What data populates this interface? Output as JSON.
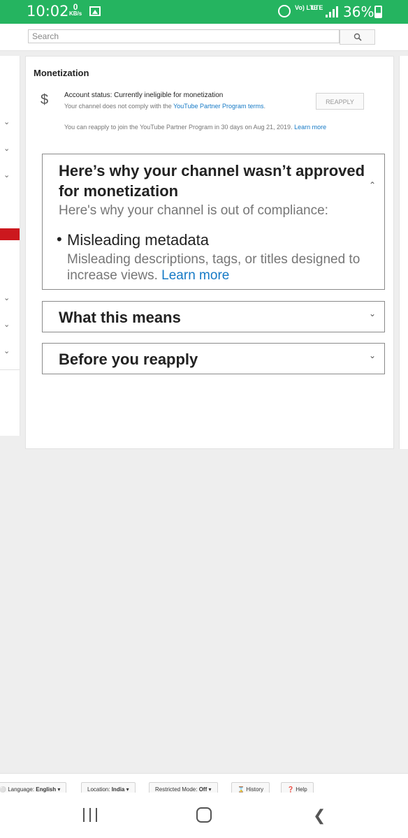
{
  "status_bar": {
    "time": "10:02",
    "net_speed_value": "0",
    "net_speed_unit": "KB/s",
    "volte": "Vo) LTE",
    "lte": "LTE",
    "battery": "36%"
  },
  "topbar": {
    "search_placeholder": "Search"
  },
  "monetization": {
    "heading": "Monetization",
    "account_status": "Account status: Currently ineligible for monetization",
    "compliance_text": "Your channel does not comply with the",
    "compliance_link": "YouTube Partner Program terms",
    "compliance_end": ".",
    "reapply_button": "REAPPLY",
    "reapply_note": "You can reapply to join the YouTube Partner Program in 30 days on Aug 21, 2019.",
    "reapply_learn_more": "Learn more"
  },
  "panels": {
    "why": {
      "title": "Here’s why your channel wasn’t approved for monetization",
      "subtitle": "Here's why your channel is out of compliance:",
      "issue": "Misleading metadata",
      "issue_desc": "Misleading descriptions, tags, or titles designed to increase views.",
      "learn_more": "Learn more"
    },
    "what": {
      "title": "What this means"
    },
    "before": {
      "title": "Before you reapply"
    }
  },
  "footer": {
    "language_label": "Language:",
    "language_value": "English",
    "location_label": "Location:",
    "location_value": "India",
    "restricted_label": "Restricted Mode:",
    "restricted_value": "Off",
    "history": "History",
    "help": "Help"
  }
}
